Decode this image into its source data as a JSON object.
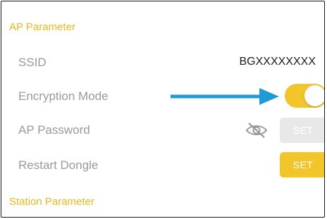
{
  "sections": {
    "ap_parameter": "AP Parameter",
    "station_parameter": "Station Parameter"
  },
  "rows": {
    "ssid": {
      "label": "SSID",
      "value": "BGXXXXXXXX"
    },
    "encryption_mode": {
      "label": "Encryption Mode",
      "toggle_on": true
    },
    "ap_password": {
      "label": "AP Password",
      "button_label": "SET",
      "visibility_icon": "eye-slash-icon"
    },
    "restart_dongle": {
      "label": "Restart Dongle",
      "button_label": "SET"
    }
  },
  "annotation": {
    "icon": "right-arrow-icon"
  },
  "colors": {
    "accent": "#F2C52A",
    "section_header": "#E8B81C",
    "label": "#9A9A9A",
    "arrow": "#1E9BD7",
    "disabled_button": "#E8E8E8"
  }
}
